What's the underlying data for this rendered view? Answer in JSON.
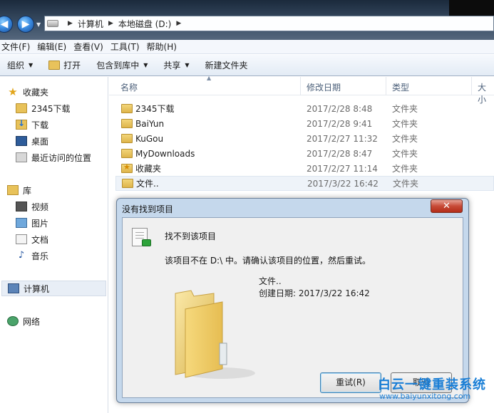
{
  "address": {
    "segments": [
      "计算机",
      "本地磁盘 (D:)"
    ]
  },
  "menu": [
    "文件(F)",
    "编辑(E)",
    "查看(V)",
    "工具(T)",
    "帮助(H)"
  ],
  "toolbar": {
    "organize": "组织",
    "open": "打开",
    "include_library": "包含到库中",
    "share": "共享",
    "new_folder": "新建文件夹"
  },
  "nav": {
    "favorites": "收藏夹",
    "fav_items": [
      "2345下载",
      "下载",
      "桌面",
      "最近访问的位置"
    ],
    "libraries": "库",
    "lib_items": [
      "视频",
      "图片",
      "文档",
      "音乐"
    ],
    "computer": "计算机",
    "network": "网络"
  },
  "columns": {
    "name": "名称",
    "date": "修改日期",
    "type": "类型",
    "size": "大小"
  },
  "files": [
    {
      "name": "2345下载",
      "date": "2017/2/28 8:48",
      "type": "文件夹"
    },
    {
      "name": "BaiYun",
      "date": "2017/2/28 9:41",
      "type": "文件夹"
    },
    {
      "name": "KuGou",
      "date": "2017/2/27 11:32",
      "type": "文件夹"
    },
    {
      "name": "MyDownloads",
      "date": "2017/2/28 8:47",
      "type": "文件夹"
    },
    {
      "name": "收藏夹",
      "date": "2017/2/27 11:14",
      "type": "文件夹"
    },
    {
      "name": "文件..",
      "date": "2017/3/22 16:42",
      "type": "文件夹"
    }
  ],
  "dialog": {
    "title": "没有找到项目",
    "close": "✕",
    "message_title": "找不到该项目",
    "message": "该项目不在 D:\\ 中。请确认该项目的位置，然后重试。",
    "file_name": "文件..",
    "created": "创建日期: 2017/3/22 16:42",
    "retry": "重试(R)",
    "cancel": "取消"
  },
  "watermark": {
    "line1": "白云一键重装系统",
    "line2": "www.baiyunxitong.com"
  }
}
